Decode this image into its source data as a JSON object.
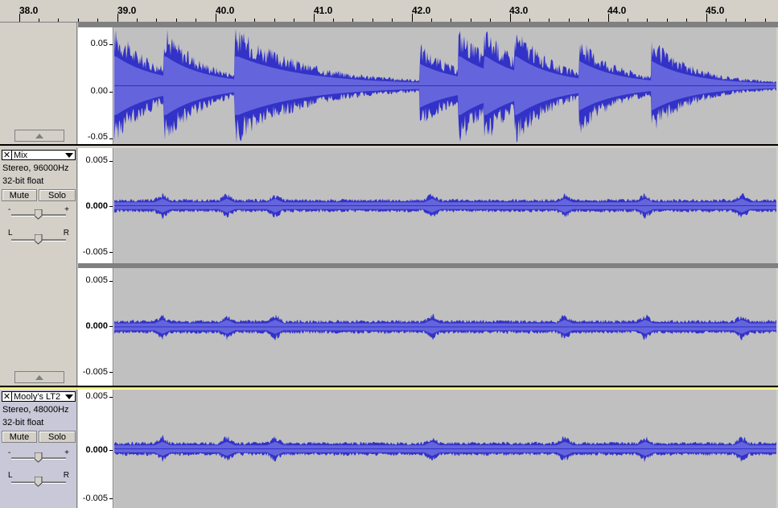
{
  "ruler": {
    "labels": [
      "38.0",
      "39.0",
      "40.0",
      "41.0",
      "42.0",
      "43.0",
      "44.0",
      "45.0"
    ]
  },
  "track1": {
    "scale_top": "0.05",
    "scale_mid": "0.00",
    "scale_bot": "-0.05"
  },
  "track2": {
    "name": "Mix",
    "close_label": "✕",
    "info_format": "Stereo, 96000Hz",
    "info_bits": "32-bit float",
    "mute_label": "Mute",
    "solo_label": "Solo",
    "gain_minus": "-",
    "gain_plus": "+",
    "pan_left": "L",
    "pan_right": "R",
    "scale_top": "0.005",
    "scale_mid": "0.000",
    "scale_bot": "-0.005"
  },
  "track3": {
    "name": "Mooly's LT2",
    "close_label": "✕",
    "info_format": "Stereo, 48000Hz",
    "info_bits": "32-bit float",
    "mute_label": "Mute",
    "solo_label": "Solo",
    "gain_minus": "-",
    "gain_plus": "+",
    "pan_left": "L",
    "pan_right": "R",
    "scale_top": "0.005",
    "scale_mid": "0.000",
    "scale_bot": "-0.005"
  },
  "colors": {
    "wave_dark": "#3232c8",
    "wave_light": "#6464dc",
    "wave_bg": "#c0c0c0",
    "selected_accent": "#ffff80"
  }
}
